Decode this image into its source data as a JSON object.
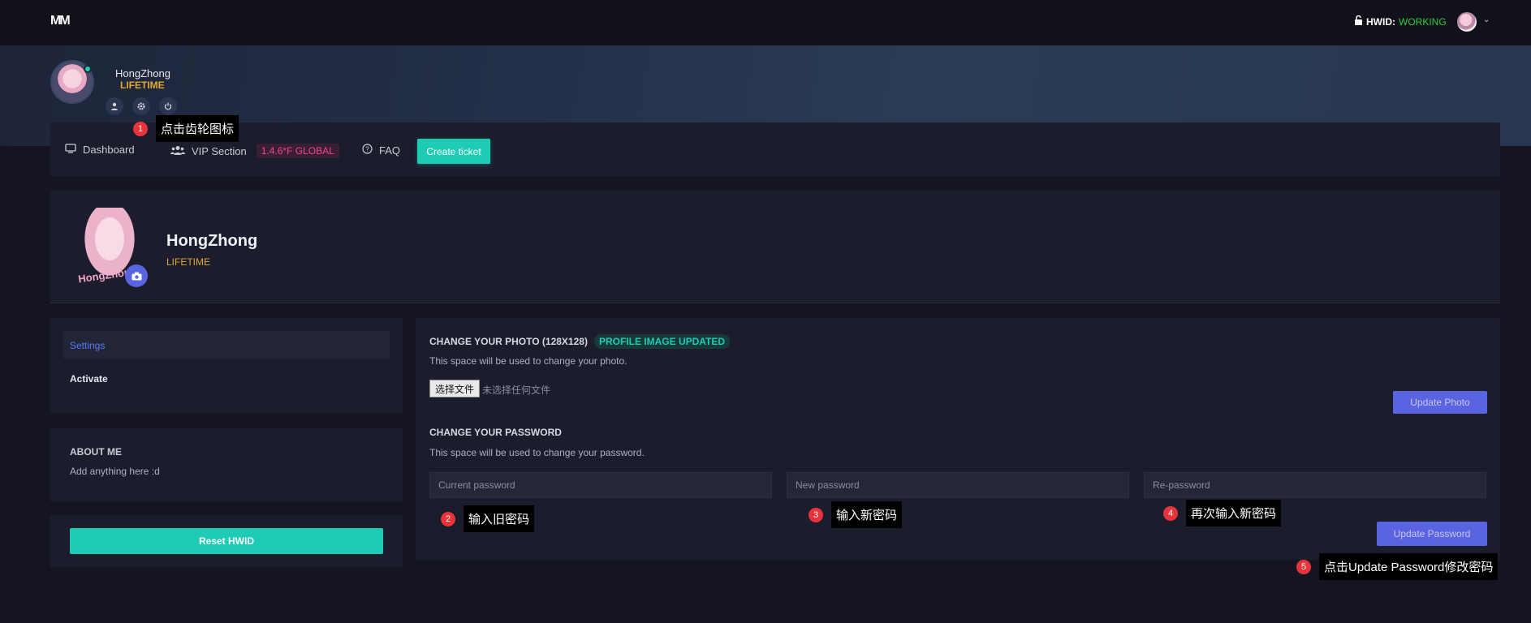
{
  "topbar": {
    "logo": "MM",
    "hwid_label": "HWID:",
    "hwid_status": "WORKING",
    "colors": {
      "status": "#2ecc40"
    }
  },
  "banner": {
    "username": "HongZhong",
    "plan": "LIFETIME"
  },
  "nav": {
    "items": [
      {
        "label": "Dashboard",
        "icon": "monitor-icon"
      },
      {
        "label": "VIP Section",
        "icon": "users-icon",
        "badge": "1.4.6*F GLOBAL"
      },
      {
        "label": "FAQ",
        "icon": "question-icon"
      }
    ],
    "create_ticket": "Create ticket"
  },
  "profile": {
    "name": "HongZhong",
    "plan": "LIFETIME",
    "pic_text": "HongZhon"
  },
  "sidebar": {
    "items": [
      {
        "label": "Settings",
        "active": true
      },
      {
        "label": "Activate",
        "active": false
      }
    ],
    "about_title": "ABOUT ME",
    "about_text": "Add anything here :d",
    "reset_button": "Reset HWID"
  },
  "photo": {
    "title": "CHANGE YOUR PHOTO (128X128)",
    "badge": "PROFILE IMAGE UPDATED",
    "desc": "This space will be used to change your photo.",
    "file_button": "选择文件",
    "file_none": "未选择任何文件",
    "update_button": "Update Photo"
  },
  "password": {
    "title": "CHANGE YOUR PASSWORD",
    "desc": "This space will be used to change your password.",
    "current_placeholder": "Current password",
    "new_placeholder": "New password",
    "re_placeholder": "Re-password",
    "update_button": "Update Password"
  },
  "callouts": [
    {
      "num": "1",
      "text": "点击齿轮图标"
    },
    {
      "num": "2",
      "text": "输入旧密码"
    },
    {
      "num": "3",
      "text": "输入新密码"
    },
    {
      "num": "4",
      "text": "再次输入新密码"
    },
    {
      "num": "5",
      "text": "点击Update Password修改密码"
    }
  ]
}
